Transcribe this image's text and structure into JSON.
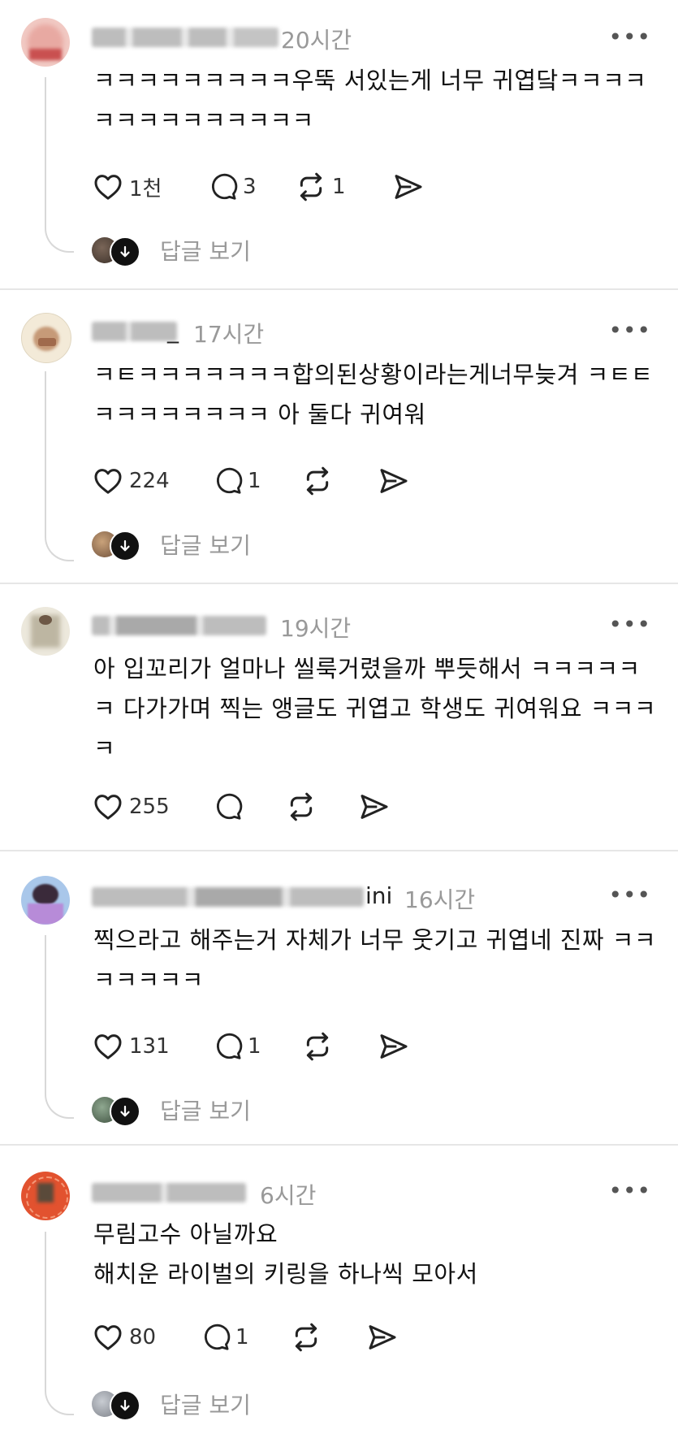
{
  "comments": [
    {
      "name_visible_tail": "",
      "time": "20시간",
      "text": "ㅋㅋㅋㅋㅋㅋㅋㅋㅋ우뚝 서있는게 너무 귀엽닼ㅋㅋㅋㅋ\nㅋㅋㅋㅋㅋㅋㅋㅋㅋㅋ",
      "likes": "1천",
      "replies_count": "3",
      "reposts": "1",
      "view_replies": "답글 보기",
      "more_icon": "more-horizontal-icon"
    },
    {
      "name_visible_tail": "_",
      "time": "17시간",
      "text": "ㅋㅌㅋㅋㅋㅋㅋㅋㅋ합의된상황이라는게너무늦겨 ㅋㅌㅌ\nㅋㅋㅋㅋㅋㅋㅋㅋ 아 둘다 귀여워",
      "likes": "224",
      "replies_count": "1",
      "reposts": "",
      "view_replies": "답글 보기",
      "more_icon": "more-horizontal-icon"
    },
    {
      "name_visible_tail": "",
      "time": "19시간",
      "text": "아 입꼬리가 얼마나 씰룩거렸을까 뿌듯해서 ㅋㅋㅋㅋㅋ\nㅋ 다가가며 찍는 앵글도 귀엽고 학생도 귀여워요 ㅋㅋㅋ\nㅋ",
      "likes": "255",
      "replies_count": "",
      "reposts": "",
      "view_replies": "",
      "more_icon": "more-horizontal-icon"
    },
    {
      "name_visible_tail": "ini",
      "time": "16시간",
      "text": "찍으라고 해주는거 자체가 너무 웃기고 귀엽네 진짜 ㅋㅋ\nㅋㅋㅋㅋㅋ",
      "likes": "131",
      "replies_count": "1",
      "reposts": "",
      "view_replies": "답글 보기",
      "more_icon": "more-horizontal-icon"
    },
    {
      "name_visible_tail": "",
      "time": "6시간",
      "text": "무림고수 아닐까요\n해치운 라이벌의 키링을 하나씩 모아서",
      "likes": "80",
      "replies_count": "1",
      "reposts": "",
      "view_replies": "답글 보기",
      "more_icon": "more-horizontal-icon"
    }
  ],
  "icons": {
    "like": "heart-icon",
    "reply": "comment-bubble-icon",
    "repost": "repost-icon",
    "share": "send-icon",
    "reply_arrow": "arrow-down-icon"
  },
  "colors": {
    "text": "#111111",
    "muted": "#999999",
    "divider": "#e6e6e6",
    "thread": "#d8d8d8"
  }
}
